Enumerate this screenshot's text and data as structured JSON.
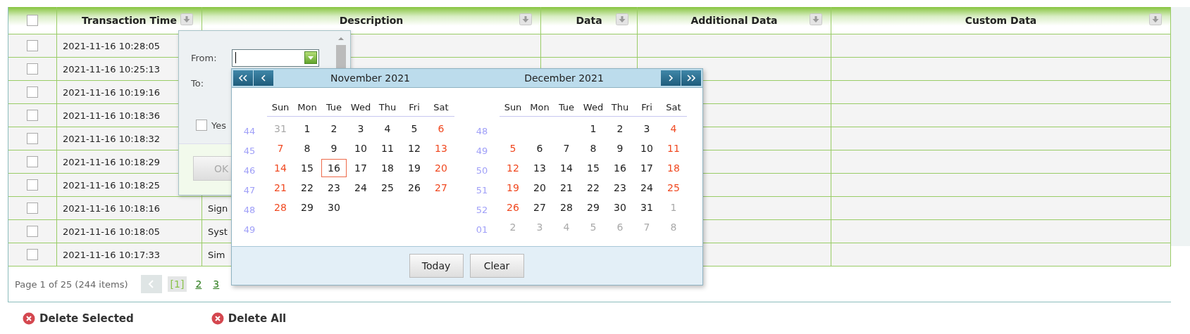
{
  "table": {
    "columns": [
      {
        "kind": "checkbox",
        "checked": false
      },
      {
        "kind": "text",
        "label": "Transaction Time",
        "sortable": true
      },
      {
        "kind": "text",
        "label": "Description",
        "sortable": true
      },
      {
        "kind": "text",
        "label": "Data",
        "sortable": true
      },
      {
        "kind": "text",
        "label": "Additional Data",
        "sortable": true
      },
      {
        "kind": "text",
        "label": "Custom Data",
        "sortable": true
      }
    ],
    "rows": [
      {
        "checked": false,
        "time": "2021-11-16 10:28:05"
      },
      {
        "checked": false,
        "time": "2021-11-16 10:25:13"
      },
      {
        "checked": false,
        "time": "2021-11-16 10:19:16"
      },
      {
        "checked": false,
        "time": "2021-11-16 10:18:36"
      },
      {
        "checked": false,
        "time": "2021-11-16 10:18:32"
      },
      {
        "checked": false,
        "time": "2021-11-16 10:18:29"
      },
      {
        "checked": false,
        "time": "2021-11-16 10:18:25"
      },
      {
        "checked": false,
        "time": "2021-11-16 10:18:16",
        "description": "Sign"
      },
      {
        "checked": false,
        "time": "2021-11-16 10:18:05",
        "description": "Syst"
      },
      {
        "checked": false,
        "time": "2021-11-16 10:17:33",
        "description": "Sim"
      }
    ]
  },
  "pager": {
    "summary": "Page 1 of 25 (244 items)",
    "prev_disabled": true,
    "pages": [
      {
        "label": "[1]",
        "selected": true
      },
      {
        "label": "2",
        "selected": false
      },
      {
        "label": "3",
        "selected": false
      }
    ]
  },
  "filter_popup": {
    "from_label": "From:",
    "to_label": "To:",
    "option": {
      "label": "Yes",
      "checked": false
    },
    "ok_button": {
      "label": "OK",
      "disabled": true
    }
  },
  "calendar": {
    "months": [
      {
        "title": "November 2021",
        "weekdays": [
          "Sun",
          "Mon",
          "Tue",
          "Wed",
          "Thu",
          "Fri",
          "Sat"
        ],
        "weeks": [
          {
            "week": "44",
            "days": [
              {
                "d": "31",
                "kind": "other",
                "selected": false
              },
              {
                "d": "1",
                "kind": "day",
                "selected": false
              },
              {
                "d": "2",
                "kind": "day",
                "selected": false
              },
              {
                "d": "3",
                "kind": "day",
                "selected": false
              },
              {
                "d": "4",
                "kind": "day",
                "selected": false
              },
              {
                "d": "5",
                "kind": "day",
                "selected": false
              },
              {
                "d": "6",
                "kind": "weekend",
                "selected": false
              }
            ]
          },
          {
            "week": "45",
            "days": [
              {
                "d": "7",
                "kind": "weekend",
                "selected": false
              },
              {
                "d": "8",
                "kind": "day",
                "selected": false
              },
              {
                "d": "9",
                "kind": "day",
                "selected": false
              },
              {
                "d": "10",
                "kind": "day",
                "selected": false
              },
              {
                "d": "11",
                "kind": "day",
                "selected": false
              },
              {
                "d": "12",
                "kind": "day",
                "selected": false
              },
              {
                "d": "13",
                "kind": "weekend",
                "selected": false
              }
            ]
          },
          {
            "week": "46",
            "days": [
              {
                "d": "14",
                "kind": "weekend",
                "selected": false
              },
              {
                "d": "15",
                "kind": "day",
                "selected": false
              },
              {
                "d": "16",
                "kind": "day",
                "selected": true
              },
              {
                "d": "17",
                "kind": "day",
                "selected": false
              },
              {
                "d": "18",
                "kind": "day",
                "selected": false
              },
              {
                "d": "19",
                "kind": "day",
                "selected": false
              },
              {
                "d": "20",
                "kind": "weekend",
                "selected": false
              }
            ]
          },
          {
            "week": "47",
            "days": [
              {
                "d": "21",
                "kind": "weekend",
                "selected": false
              },
              {
                "d": "22",
                "kind": "day",
                "selected": false
              },
              {
                "d": "23",
                "kind": "day",
                "selected": false
              },
              {
                "d": "24",
                "kind": "day",
                "selected": false
              },
              {
                "d": "25",
                "kind": "day",
                "selected": false
              },
              {
                "d": "26",
                "kind": "day",
                "selected": false
              },
              {
                "d": "27",
                "kind": "weekend",
                "selected": false
              }
            ]
          },
          {
            "week": "48",
            "days": [
              {
                "d": "28",
                "kind": "weekend",
                "selected": false
              },
              {
                "d": "29",
                "kind": "day",
                "selected": false
              },
              {
                "d": "30",
                "kind": "day",
                "selected": false
              },
              {
                "kind": "blank"
              },
              {
                "kind": "blank"
              },
              {
                "kind": "blank"
              },
              {
                "kind": "blank"
              }
            ]
          },
          {
            "week": "49"
          }
        ]
      },
      {
        "title": "December 2021",
        "weekdays": [
          "Sun",
          "Mon",
          "Tue",
          "Wed",
          "Thu",
          "Fri",
          "Sat"
        ],
        "weeks": [
          {
            "week": "48",
            "days": [
              {
                "kind": "blank"
              },
              {
                "kind": "blank"
              },
              {
                "kind": "blank"
              },
              {
                "d": "1",
                "kind": "day",
                "selected": false
              },
              {
                "d": "2",
                "kind": "day",
                "selected": false
              },
              {
                "d": "3",
                "kind": "day",
                "selected": false
              },
              {
                "d": "4",
                "kind": "weekend",
                "selected": false
              }
            ]
          },
          {
            "week": "49",
            "days": [
              {
                "d": "5",
                "kind": "weekend",
                "selected": false
              },
              {
                "d": "6",
                "kind": "day",
                "selected": false
              },
              {
                "d": "7",
                "kind": "day",
                "selected": false
              },
              {
                "d": "8",
                "kind": "day",
                "selected": false
              },
              {
                "d": "9",
                "kind": "day",
                "selected": false
              },
              {
                "d": "10",
                "kind": "day",
                "selected": false
              },
              {
                "d": "11",
                "kind": "weekend",
                "selected": false
              }
            ]
          },
          {
            "week": "50",
            "days": [
              {
                "d": "12",
                "kind": "weekend",
                "selected": false
              },
              {
                "d": "13",
                "kind": "day",
                "selected": false
              },
              {
                "d": "14",
                "kind": "day",
                "selected": false
              },
              {
                "d": "15",
                "kind": "day",
                "selected": false
              },
              {
                "d": "16",
                "kind": "day",
                "selected": false
              },
              {
                "d": "17",
                "kind": "day",
                "selected": false
              },
              {
                "d": "18",
                "kind": "weekend",
                "selected": false
              }
            ]
          },
          {
            "week": "51",
            "days": [
              {
                "d": "19",
                "kind": "weekend",
                "selected": false
              },
              {
                "d": "20",
                "kind": "day",
                "selected": false
              },
              {
                "d": "21",
                "kind": "day",
                "selected": false
              },
              {
                "d": "22",
                "kind": "day",
                "selected": false
              },
              {
                "d": "23",
                "kind": "day",
                "selected": false
              },
              {
                "d": "24",
                "kind": "day",
                "selected": false
              },
              {
                "d": "25",
                "kind": "weekend",
                "selected": false
              }
            ]
          },
          {
            "week": "52",
            "days": [
              {
                "d": "26",
                "kind": "weekend",
                "selected": false
              },
              {
                "d": "27",
                "kind": "day",
                "selected": false
              },
              {
                "d": "28",
                "kind": "day",
                "selected": false
              },
              {
                "d": "29",
                "kind": "day",
                "selected": false
              },
              {
                "d": "30",
                "kind": "day",
                "selected": false
              },
              {
                "d": "31",
                "kind": "day",
                "selected": false
              },
              {
                "d": "1",
                "kind": "other",
                "selected": false
              }
            ]
          },
          {
            "week": "01",
            "days": [
              {
                "d": "2",
                "kind": "other",
                "selected": false
              },
              {
                "d": "3",
                "kind": "other",
                "selected": false
              },
              {
                "d": "4",
                "kind": "other",
                "selected": false
              },
              {
                "d": "5",
                "kind": "other",
                "selected": false
              },
              {
                "d": "6",
                "kind": "other",
                "selected": false
              },
              {
                "d": "7",
                "kind": "other",
                "selected": false
              },
              {
                "d": "8",
                "kind": "other",
                "selected": false
              }
            ]
          }
        ]
      }
    ],
    "buttons": [
      "Today",
      "Clear"
    ]
  },
  "actions": [
    {
      "label": "Delete Selected"
    },
    {
      "label": "Delete All"
    }
  ]
}
